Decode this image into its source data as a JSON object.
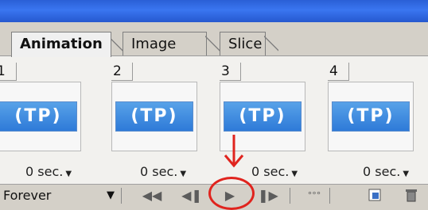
{
  "tabs": [
    {
      "label": "Animation",
      "active": true
    },
    {
      "label": "Image Map",
      "active": false
    },
    {
      "label": "Slice",
      "active": false
    }
  ],
  "frames": [
    {
      "number": "1",
      "thumb_text": "(TP)",
      "delay": "0 sec."
    },
    {
      "number": "2",
      "thumb_text": "(TP)",
      "delay": "0 sec."
    },
    {
      "number": "3",
      "thumb_text": "(TP)",
      "delay": "0 sec."
    },
    {
      "number": "4",
      "thumb_text": "(TP)",
      "delay": "0 sec."
    }
  ],
  "toolbar": {
    "loop_value": "Forever",
    "buttons": [
      "first-frame",
      "previous-frame",
      "play",
      "next-frame",
      "tween",
      "new-frame",
      "delete-frame"
    ]
  },
  "colors": {
    "accent": "#2e7ad8",
    "highlight": "#e0241e"
  }
}
